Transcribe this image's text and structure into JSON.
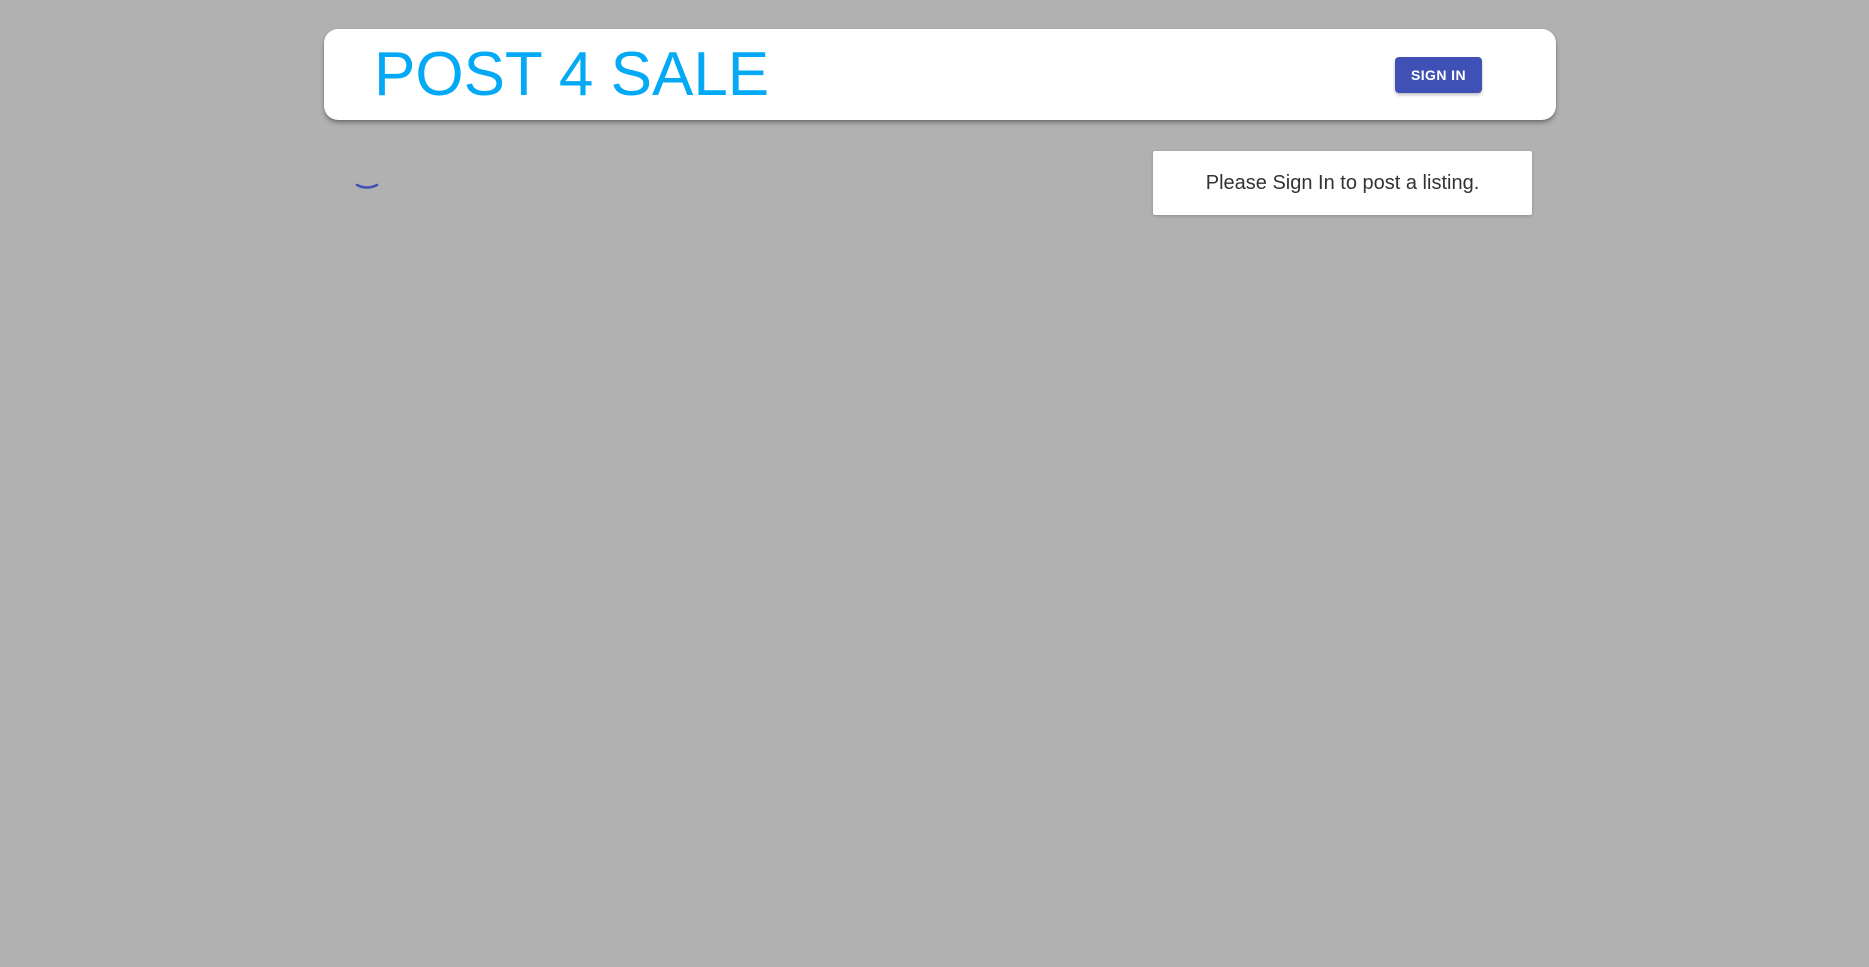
{
  "header": {
    "brand": "POST 4 SALE",
    "sign_in_label": "SIGN IN"
  },
  "main": {
    "notice": "Please Sign In to post a listing.",
    "loading_icon": "spinner-icon"
  },
  "colors": {
    "background": "#b1b1b1",
    "brand": "#03a9f4",
    "primary_button": "#3f51b5",
    "spinner": "#3f51b5"
  }
}
